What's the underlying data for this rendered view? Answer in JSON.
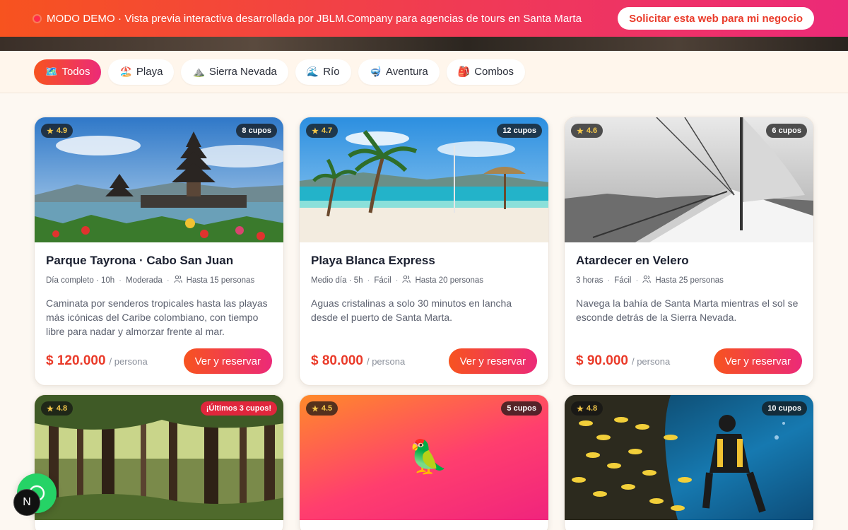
{
  "banner": {
    "message": "MODO DEMO · Vista previa interactiva desarrollada por JBLM.Company para agencias de tours en Santa Marta",
    "cta": "Solicitar esta web para mi negocio",
    "colors": {
      "gradient_start": "#f7531f",
      "gradient_end": "#ec2a78"
    }
  },
  "filters": [
    {
      "icon": "map-icon",
      "glyph": "🗺️",
      "label": "Todos",
      "active": true
    },
    {
      "icon": "beach-icon",
      "glyph": "🏖️",
      "label": "Playa",
      "active": false
    },
    {
      "icon": "mountain-icon",
      "glyph": "⛰️",
      "label": "Sierra Nevada",
      "active": false
    },
    {
      "icon": "wave-icon",
      "glyph": "🌊",
      "label": "Río",
      "active": false
    },
    {
      "icon": "snorkel-icon",
      "glyph": "🤿",
      "label": "Aventura",
      "active": false
    },
    {
      "icon": "backpack-icon",
      "glyph": "🎒",
      "label": "Combos",
      "active": false
    }
  ],
  "tours": [
    {
      "rating": "4.9",
      "cupos": "8 cupos",
      "cupos_alert": false,
      "title": "Parque Tayrona · Cabo San Juan",
      "duration": "Día completo · 10h",
      "difficulty": "Moderada",
      "group": "Hasta 15 personas",
      "description": "Caminata por senderos tropicales hasta las playas más icónicas del Caribe colombiano, con tiempo libre para nadar y almorzar frente al mar.",
      "price": "$ 120.000",
      "per": "/ persona",
      "cta": "Ver y reservar",
      "image": "temple-lake"
    },
    {
      "rating": "4.7",
      "cupos": "12 cupos",
      "cupos_alert": false,
      "title": "Playa Blanca Express",
      "duration": "Medio día · 5h",
      "difficulty": "Fácil",
      "group": "Hasta 20 personas",
      "description": "Aguas cristalinas a solo 30 minutos en lancha desde el puerto de Santa Marta.",
      "price": "$ 80.000",
      "per": "/ persona",
      "cta": "Ver y reservar",
      "image": "beach"
    },
    {
      "rating": "4.6",
      "cupos": "6 cupos",
      "cupos_alert": false,
      "title": "Atardecer en Velero",
      "duration": "3 horas",
      "difficulty": "Fácil",
      "group": "Hasta 25 personas",
      "description": "Navega la bahía de Santa Marta mientras el sol se esconde detrás de la Sierra Nevada.",
      "price": "$ 90.000",
      "per": "/ persona",
      "cta": "Ver y reservar",
      "image": "sailboat"
    },
    {
      "rating": "4.8",
      "cupos": "¡Últimos 3 cupos!",
      "cupos_alert": true,
      "image": "forest"
    },
    {
      "rating": "4.5",
      "cupos": "5 cupos",
      "cupos_alert": false,
      "image": "parrot"
    },
    {
      "rating": "4.8",
      "cupos": "10 cupos",
      "cupos_alert": false,
      "image": "diver"
    }
  ],
  "floating": {
    "whatsapp_icon": "whatsapp-icon",
    "badge": "N"
  }
}
